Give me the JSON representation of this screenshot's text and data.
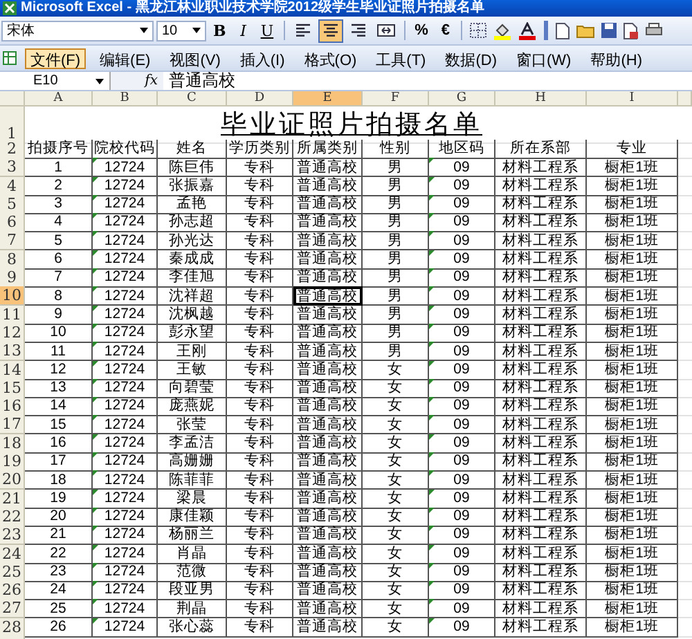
{
  "window": {
    "title": "Microsoft Excel - 黑龙江林业职业技术学院2012级学生毕业证照片拍摄名单"
  },
  "toolbar": {
    "font": "宋体",
    "size": "10",
    "format_buttons": [
      "B",
      "I",
      "U"
    ],
    "align_buttons": [
      {
        "kind": "left",
        "selected": false
      },
      {
        "kind": "center",
        "selected": true
      },
      {
        "kind": "right",
        "selected": false
      },
      {
        "kind": "merge",
        "selected": false
      }
    ],
    "number_buttons": [
      "%",
      "€"
    ]
  },
  "menu": [
    {
      "label": "文件(F)",
      "selected": true
    },
    {
      "label": "编辑(E)",
      "selected": false
    },
    {
      "label": "视图(V)",
      "selected": false
    },
    {
      "label": "插入(I)",
      "selected": false
    },
    {
      "label": "格式(O)",
      "selected": false
    },
    {
      "label": "工具(T)",
      "selected": false
    },
    {
      "label": "数据(D)",
      "selected": false
    },
    {
      "label": "窗口(W)",
      "selected": false
    },
    {
      "label": "帮助(H)",
      "selected": false
    }
  ],
  "formula_bar": {
    "name_box": "E10",
    "fx": "fx",
    "value": "普通高校"
  },
  "sheet": {
    "columns": [
      {
        "label": "A",
        "selected": false
      },
      {
        "label": "B",
        "selected": false
      },
      {
        "label": "C",
        "selected": false
      },
      {
        "label": "D",
        "selected": false
      },
      {
        "label": "E",
        "selected": true
      },
      {
        "label": "F",
        "selected": false
      },
      {
        "label": "G",
        "selected": false
      },
      {
        "label": "H",
        "selected": false
      },
      {
        "label": "I",
        "selected": false
      }
    ],
    "title_row": {
      "number": "1",
      "text": "毕业证照片拍摄名单"
    },
    "header_row": {
      "number": "2",
      "cells": [
        "拍摄序号",
        "院校代码",
        "姓名",
        "学历类别",
        "所属类别",
        "性别",
        "地区码",
        "所在系部",
        "专业"
      ]
    },
    "rows": [
      {
        "number": "3",
        "selected": false,
        "cells": [
          "1",
          "12724",
          "陈巨伟",
          "专科",
          "普通高校",
          "男",
          "09",
          "材料工程系",
          "橱柜1班"
        ]
      },
      {
        "number": "4",
        "selected": false,
        "cells": [
          "2",
          "12724",
          "张振嘉",
          "专科",
          "普通高校",
          "男",
          "09",
          "材料工程系",
          "橱柜1班"
        ]
      },
      {
        "number": "5",
        "selected": false,
        "cells": [
          "3",
          "12724",
          "孟艳",
          "专科",
          "普通高校",
          "男",
          "09",
          "材料工程系",
          "橱柜1班"
        ]
      },
      {
        "number": "6",
        "selected": false,
        "cells": [
          "4",
          "12724",
          "孙志超",
          "专科",
          "普通高校",
          "男",
          "09",
          "材料工程系",
          "橱柜1班"
        ]
      },
      {
        "number": "7",
        "selected": false,
        "cells": [
          "5",
          "12724",
          "孙光达",
          "专科",
          "普通高校",
          "男",
          "09",
          "材料工程系",
          "橱柜1班"
        ]
      },
      {
        "number": "8",
        "selected": false,
        "cells": [
          "6",
          "12724",
          "秦成成",
          "专科",
          "普通高校",
          "男",
          "09",
          "材料工程系",
          "橱柜1班"
        ]
      },
      {
        "number": "9",
        "selected": false,
        "cells": [
          "7",
          "12724",
          "李佳旭",
          "专科",
          "普通高校",
          "男",
          "09",
          "材料工程系",
          "橱柜1班"
        ]
      },
      {
        "number": "10",
        "selected": true,
        "cells": [
          "8",
          "12724",
          "沈祥超",
          "专科",
          "普通高校",
          "男",
          "09",
          "材料工程系",
          "橱柜1班"
        ]
      },
      {
        "number": "11",
        "selected": false,
        "cells": [
          "9",
          "12724",
          "沈枫越",
          "专科",
          "普通高校",
          "男",
          "09",
          "材料工程系",
          "橱柜1班"
        ]
      },
      {
        "number": "12",
        "selected": false,
        "cells": [
          "10",
          "12724",
          "彭永望",
          "专科",
          "普通高校",
          "男",
          "09",
          "材料工程系",
          "橱柜1班"
        ]
      },
      {
        "number": "13",
        "selected": false,
        "cells": [
          "11",
          "12724",
          "王刚",
          "专科",
          "普通高校",
          "男",
          "09",
          "材料工程系",
          "橱柜1班"
        ]
      },
      {
        "number": "14",
        "selected": false,
        "cells": [
          "12",
          "12724",
          "王敏",
          "专科",
          "普通高校",
          "女",
          "09",
          "材料工程系",
          "橱柜1班"
        ]
      },
      {
        "number": "15",
        "selected": false,
        "cells": [
          "13",
          "12724",
          "向碧莹",
          "专科",
          "普通高校",
          "女",
          "09",
          "材料工程系",
          "橱柜1班"
        ]
      },
      {
        "number": "16",
        "selected": false,
        "cells": [
          "14",
          "12724",
          "庞燕妮",
          "专科",
          "普通高校",
          "女",
          "09",
          "材料工程系",
          "橱柜1班"
        ]
      },
      {
        "number": "17",
        "selected": false,
        "cells": [
          "15",
          "12724",
          "张莹",
          "专科",
          "普通高校",
          "女",
          "09",
          "材料工程系",
          "橱柜1班"
        ]
      },
      {
        "number": "18",
        "selected": false,
        "cells": [
          "16",
          "12724",
          "李孟洁",
          "专科",
          "普通高校",
          "女",
          "09",
          "材料工程系",
          "橱柜1班"
        ]
      },
      {
        "number": "19",
        "selected": false,
        "cells": [
          "17",
          "12724",
          "高姗姗",
          "专科",
          "普通高校",
          "女",
          "09",
          "材料工程系",
          "橱柜1班"
        ]
      },
      {
        "number": "20",
        "selected": false,
        "cells": [
          "18",
          "12724",
          "陈菲菲",
          "专科",
          "普通高校",
          "女",
          "09",
          "材料工程系",
          "橱柜1班"
        ]
      },
      {
        "number": "21",
        "selected": false,
        "cells": [
          "19",
          "12724",
          "梁晨",
          "专科",
          "普通高校",
          "女",
          "09",
          "材料工程系",
          "橱柜1班"
        ]
      },
      {
        "number": "22",
        "selected": false,
        "cells": [
          "20",
          "12724",
          "康佳颖",
          "专科",
          "普通高校",
          "女",
          "09",
          "材料工程系",
          "橱柜1班"
        ]
      },
      {
        "number": "23",
        "selected": false,
        "cells": [
          "21",
          "12724",
          "杨丽兰",
          "专科",
          "普通高校",
          "女",
          "09",
          "材料工程系",
          "橱柜1班"
        ]
      },
      {
        "number": "24",
        "selected": false,
        "cells": [
          "22",
          "12724",
          "肖晶",
          "专科",
          "普通高校",
          "女",
          "09",
          "材料工程系",
          "橱柜1班"
        ]
      },
      {
        "number": "25",
        "selected": false,
        "cells": [
          "23",
          "12724",
          "范微",
          "专科",
          "普通高校",
          "女",
          "09",
          "材料工程系",
          "橱柜1班"
        ]
      },
      {
        "number": "26",
        "selected": false,
        "cells": [
          "24",
          "12724",
          "段亚男",
          "专科",
          "普通高校",
          "女",
          "09",
          "材料工程系",
          "橱柜1班"
        ]
      },
      {
        "number": "27",
        "selected": false,
        "cells": [
          "25",
          "12724",
          "荆晶",
          "专科",
          "普通高校",
          "女",
          "09",
          "材料工程系",
          "橱柜1班"
        ]
      },
      {
        "number": "28",
        "selected": false,
        "cells": [
          "26",
          "12724",
          "张心蕊",
          "专科",
          "普通高校",
          "女",
          "09",
          "材料工程系",
          "橱柜1班"
        ]
      }
    ]
  }
}
